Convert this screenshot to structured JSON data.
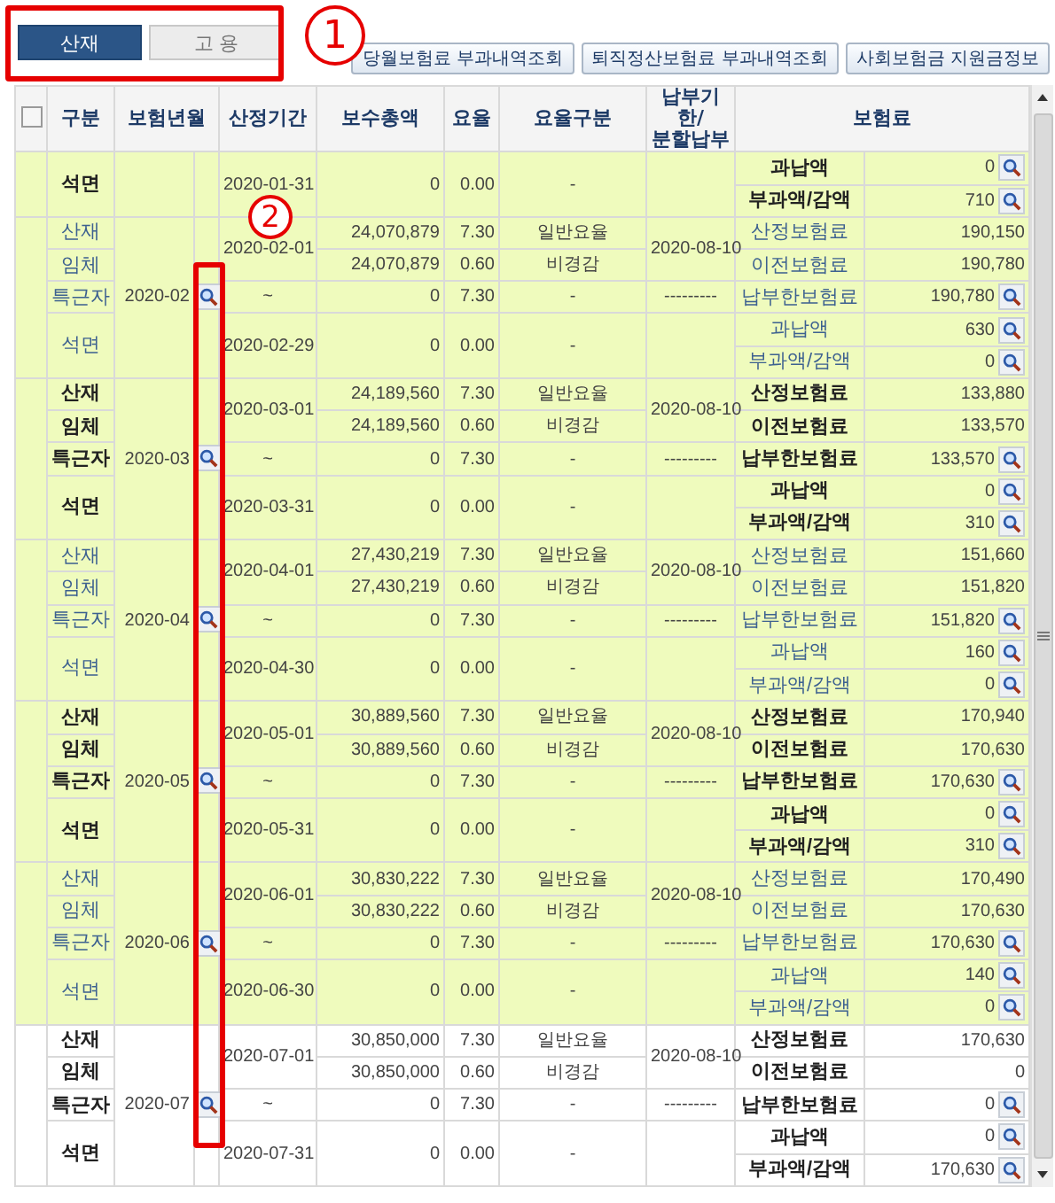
{
  "tabs": [
    {
      "label": "산재",
      "selected": true
    },
    {
      "label": "고 용",
      "selected": false
    }
  ],
  "buttons": [
    "당월보험료 부과내역조회",
    "퇴직정산보험료 부과내역조회",
    "사회보험금 지원금정보"
  ],
  "annotations": [
    {
      "label": "1"
    },
    {
      "label": "2"
    }
  ],
  "table": {
    "select_all": {
      "checked": false
    },
    "columns": [
      "구분",
      "보험년월",
      "산정기간",
      "보수총액",
      "요율",
      "요율구분",
      "납부기한/\n분할납부",
      "보험료"
    ],
    "months": [
      {
        "highlighted": true,
        "bold": true,
        "period_end": "2020-01-31",
        "rows": [
          {
            "label": "석면",
            "total": "0",
            "rate": "0.00",
            "rate_type": "-"
          }
        ],
        "fees": [
          {
            "label": "과납액",
            "value": "0",
            "search": true
          },
          {
            "label": "부과액/감액",
            "value": "710",
            "search": true
          }
        ]
      },
      {
        "year_month": "2020-02",
        "search": true,
        "highlighted": true,
        "bold": false,
        "period_start": "2020-02-01",
        "period_mid": "~",
        "period_end": "2020-02-29",
        "due_date": "2020-08-10",
        "due_mid": "---------",
        "rows": [
          {
            "label": "산재",
            "total": "24,070,879",
            "rate": "7.30",
            "rate_type": "일반요율"
          },
          {
            "label": "임체",
            "total": "24,070,879",
            "rate": "0.60",
            "rate_type": "비경감"
          },
          {
            "label": "특근자",
            "total": "0",
            "rate": "7.30",
            "rate_type": "-"
          },
          {
            "label": "석면",
            "total": "0",
            "rate": "0.00",
            "rate_type": "-"
          }
        ],
        "fees": [
          {
            "label": "산정보험료",
            "value": "190,150",
            "search": false
          },
          {
            "label": "이전보험료",
            "value": "190,780",
            "search": false
          },
          {
            "label": "납부한보험료",
            "value": "190,780",
            "search": true
          },
          {
            "label": "과납액",
            "value": "630",
            "search": true
          },
          {
            "label": "부과액/감액",
            "value": "0",
            "search": true
          }
        ]
      },
      {
        "year_month": "2020-03",
        "search": true,
        "highlighted": true,
        "bold": true,
        "period_start": "2020-03-01",
        "period_mid": "~",
        "period_end": "2020-03-31",
        "due_date": "2020-08-10",
        "due_mid": "---------",
        "rows": [
          {
            "label": "산재",
            "total": "24,189,560",
            "rate": "7.30",
            "rate_type": "일반요율"
          },
          {
            "label": "임체",
            "total": "24,189,560",
            "rate": "0.60",
            "rate_type": "비경감"
          },
          {
            "label": "특근자",
            "total": "0",
            "rate": "7.30",
            "rate_type": "-"
          },
          {
            "label": "석면",
            "total": "0",
            "rate": "0.00",
            "rate_type": "-"
          }
        ],
        "fees": [
          {
            "label": "산정보험료",
            "value": "133,880",
            "search": false
          },
          {
            "label": "이전보험료",
            "value": "133,570",
            "search": false
          },
          {
            "label": "납부한보험료",
            "value": "133,570",
            "search": true
          },
          {
            "label": "과납액",
            "value": "0",
            "search": true
          },
          {
            "label": "부과액/감액",
            "value": "310",
            "search": true
          }
        ]
      },
      {
        "year_month": "2020-04",
        "search": true,
        "highlighted": true,
        "bold": false,
        "period_start": "2020-04-01",
        "period_mid": "~",
        "period_end": "2020-04-30",
        "due_date": "2020-08-10",
        "due_mid": "---------",
        "rows": [
          {
            "label": "산재",
            "total": "27,430,219",
            "rate": "7.30",
            "rate_type": "일반요율"
          },
          {
            "label": "임체",
            "total": "27,430,219",
            "rate": "0.60",
            "rate_type": "비경감"
          },
          {
            "label": "특근자",
            "total": "0",
            "rate": "7.30",
            "rate_type": "-"
          },
          {
            "label": "석면",
            "total": "0",
            "rate": "0.00",
            "rate_type": "-"
          }
        ],
        "fees": [
          {
            "label": "산정보험료",
            "value": "151,660",
            "search": false
          },
          {
            "label": "이전보험료",
            "value": "151,820",
            "search": false
          },
          {
            "label": "납부한보험료",
            "value": "151,820",
            "search": true
          },
          {
            "label": "과납액",
            "value": "160",
            "search": true
          },
          {
            "label": "부과액/감액",
            "value": "0",
            "search": true
          }
        ]
      },
      {
        "year_month": "2020-05",
        "search": true,
        "highlighted": true,
        "bold": true,
        "period_start": "2020-05-01",
        "period_mid": "~",
        "period_end": "2020-05-31",
        "due_date": "2020-08-10",
        "due_mid": "---------",
        "rows": [
          {
            "label": "산재",
            "total": "30,889,560",
            "rate": "7.30",
            "rate_type": "일반요율"
          },
          {
            "label": "임체",
            "total": "30,889,560",
            "rate": "0.60",
            "rate_type": "비경감"
          },
          {
            "label": "특근자",
            "total": "0",
            "rate": "7.30",
            "rate_type": "-"
          },
          {
            "label": "석면",
            "total": "0",
            "rate": "0.00",
            "rate_type": "-"
          }
        ],
        "fees": [
          {
            "label": "산정보험료",
            "value": "170,940",
            "search": false
          },
          {
            "label": "이전보험료",
            "value": "170,630",
            "search": false
          },
          {
            "label": "납부한보험료",
            "value": "170,630",
            "search": true
          },
          {
            "label": "과납액",
            "value": "0",
            "search": true
          },
          {
            "label": "부과액/감액",
            "value": "310",
            "search": true
          }
        ]
      },
      {
        "year_month": "2020-06",
        "search": true,
        "highlighted": true,
        "bold": false,
        "period_start": "2020-06-01",
        "period_mid": "~",
        "period_end": "2020-06-30",
        "due_date": "2020-08-10",
        "due_mid": "---------",
        "rows": [
          {
            "label": "산재",
            "total": "30,830,222",
            "rate": "7.30",
            "rate_type": "일반요율"
          },
          {
            "label": "임체",
            "total": "30,830,222",
            "rate": "0.60",
            "rate_type": "비경감"
          },
          {
            "label": "특근자",
            "total": "0",
            "rate": "7.30",
            "rate_type": "-"
          },
          {
            "label": "석면",
            "total": "0",
            "rate": "0.00",
            "rate_type": "-"
          }
        ],
        "fees": [
          {
            "label": "산정보험료",
            "value": "170,490",
            "search": false
          },
          {
            "label": "이전보험료",
            "value": "170,630",
            "search": false
          },
          {
            "label": "납부한보험료",
            "value": "170,630",
            "search": true
          },
          {
            "label": "과납액",
            "value": "140",
            "search": true
          },
          {
            "label": "부과액/감액",
            "value": "0",
            "search": true
          }
        ]
      },
      {
        "year_month": "2020-07",
        "search": true,
        "highlighted": false,
        "bold": true,
        "period_start": "2020-07-01",
        "period_mid": "~",
        "period_end": "2020-07-31",
        "due_date": "2020-08-10",
        "due_mid": "---------",
        "rows": [
          {
            "label": "산재",
            "total": "30,850,000",
            "rate": "7.30",
            "rate_type": "일반요율"
          },
          {
            "label": "임체",
            "total": "30,850,000",
            "rate": "0.60",
            "rate_type": "비경감"
          },
          {
            "label": "특근자",
            "total": "0",
            "rate": "7.30",
            "rate_type": "-"
          },
          {
            "label": "석면",
            "total": "0",
            "rate": "0.00",
            "rate_type": "-"
          }
        ],
        "fees": [
          {
            "label": "산정보험료",
            "value": "170,630",
            "search": false
          },
          {
            "label": "이전보험료",
            "value": "0",
            "search": false
          },
          {
            "label": "납부한보험료",
            "value": "0",
            "search": true
          },
          {
            "label": "과납액",
            "value": "0",
            "search": true
          },
          {
            "label": "부과액/감액",
            "value": "170,630",
            "search": true
          }
        ]
      }
    ]
  }
}
